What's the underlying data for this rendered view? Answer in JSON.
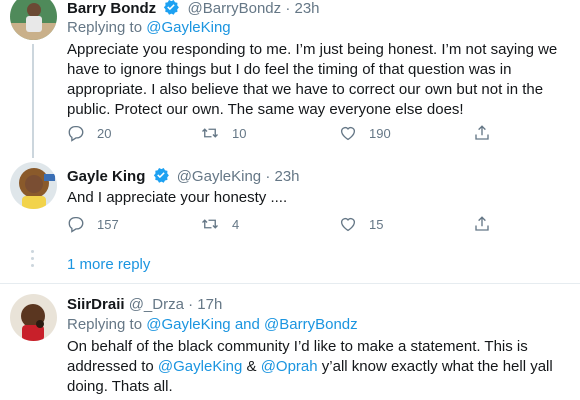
{
  "tweets": [
    {
      "display_name": "Barry Bondz",
      "handle": "@BarryBondz",
      "separator": "·",
      "time": "23h",
      "replying_label": "Replying to",
      "replying_to": [
        "@GayleKing"
      ],
      "verified": true,
      "text": "Appreciate you responding to me. I’m just being honest. I’m not saying we have to ignore things but I do feel the timing of that question was in appropriate. I also believe that we have to correct our own but not in the public. Protect our own. The same way everyone else does!",
      "replies": "20",
      "retweets": "10",
      "likes": "190"
    },
    {
      "display_name": "Gayle King",
      "handle": "@GayleKing",
      "separator": "·",
      "time": "23h",
      "verified": true,
      "text": "And I appreciate your honesty ....",
      "replies": "157",
      "retweets": "4",
      "likes": "15"
    },
    {
      "display_name": "SiirDraii",
      "handle": "@_Drza",
      "separator": "·",
      "time": "17h",
      "replying_label": "Replying to",
      "replying_to": [
        "@GayleKing",
        "@BarryBondz"
      ],
      "replying_joiner": "and",
      "verified": false,
      "text_parts": [
        "On behalf of the black community I’d like to make a statement. This is addressed to ",
        "@GayleKing",
        " & ",
        "@Oprah",
        " y’all know exactly what the hell yall doing. Thats all."
      ]
    }
  ],
  "more_replies": "1 more reply",
  "colors": {
    "link": "#1b95e0",
    "muted": "#657786",
    "text": "#14171a",
    "verified": "#1da1f2"
  },
  "icons": [
    "reply-icon",
    "retweet-icon",
    "like-icon",
    "share-icon",
    "verified-badge-icon"
  ]
}
